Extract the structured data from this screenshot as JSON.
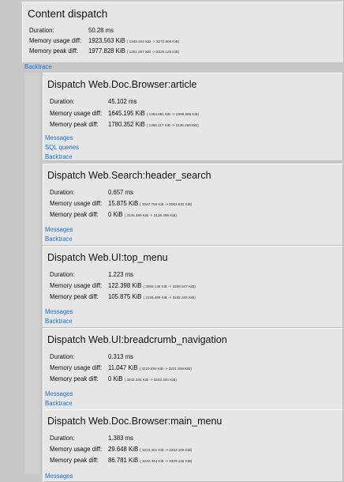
{
  "top": {
    "title": "Content dispatch",
    "labels": {
      "duration": "Duration:",
      "mem_usage": "Memory usage diff:",
      "mem_peak": "Memory peak diff:"
    },
    "duration": "50.28 ms",
    "mem_usage": "1923.563 KiB",
    "mem_usage_detail": "( 1349.344 KiB -> 3272.906 KiB)",
    "mem_peak": "1977.828 KiB",
    "mem_peak_detail": "( 1351.297 KiB -> 3329.125 KiB)",
    "backtrace": "Backtrace"
  },
  "labels": {
    "duration": "Duration:",
    "mem_usage": "Memory usage diff:",
    "mem_peak": "Memory peak diff:",
    "messages": "Messages",
    "sql": "SQL queries",
    "backtrace": "Backtrace"
  },
  "panels": [
    {
      "title": "Dispatch Web.Doc.Browser:article",
      "duration": "45.102 ms",
      "mem_usage": "1645.195 KiB",
      "mem_usage_detail": "( 1353.891 KiB -> 2999.086 KiB)",
      "mem_peak": "1780.352 KiB",
      "mem_peak_detail": "( 1356.117 KiB -> 3136.469 KiB)",
      "links": [
        "Messages",
        "SQL queries",
        "Backtrace"
      ]
    },
    {
      "title": "Dispatch Web.Search:header_search",
      "duration": "0.657 ms",
      "mem_usage": "15.875 KiB",
      "mem_usage_detail": "( 3067.758 KiB -> 3083.633 KiB)",
      "mem_peak": "0 KiB",
      "mem_peak_detail": "( 3136.469 KiB -> 3136.469 KiB)",
      "links": [
        "Messages",
        "Backtrace"
      ]
    },
    {
      "title": "Dispatch Web.UI:top_menu",
      "duration": "1.223 ms",
      "mem_usage": "122.398 KiB",
      "mem_usage_detail": "( 3086.148 KiB -> 3208.547 KiB)",
      "mem_peak": "105.875 KiB",
      "mem_peak_detail": "( 3136.469 KiB -> 3242.344 KiB)",
      "links": [
        "Messages",
        "Backtrace"
      ]
    },
    {
      "title": "Dispatch Web.UI:breadcrumb_navigation",
      "duration": "0.313 ms",
      "mem_usage": "11.047 KiB",
      "mem_usage_detail": "( 3210.492 KiB -> 3221.539 KiB)",
      "mem_peak": "0 KiB",
      "mem_peak_detail": "( 3242.344 KiB -> 3242.344 KiB)",
      "links": [
        "Messages",
        "Backtrace"
      ]
    },
    {
      "title": "Dispatch Web.Doc.Browser:main_menu",
      "duration": "1.383 ms",
      "mem_usage": "29.648 KiB",
      "mem_usage_detail": "( 3223.461 KiB -> 3253.109 KiB)",
      "mem_peak": "86.781 KiB",
      "mem_peak_detail": "( 3242.344 KiB -> 3329.125 KiB)",
      "links": [
        "Messages"
      ]
    }
  ]
}
